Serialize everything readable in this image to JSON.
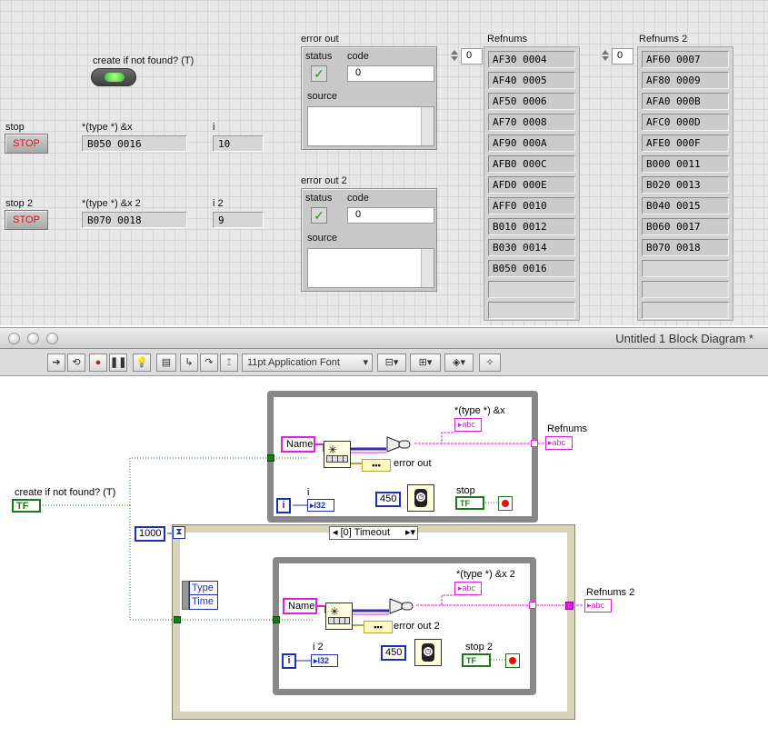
{
  "front_panel": {
    "create_label": "create if not found? (T)",
    "stop": {
      "label": "stop",
      "button": "STOP"
    },
    "stop2": {
      "label": "stop 2",
      "button": "STOP"
    },
    "typex": {
      "label": "*(type *) &x",
      "value": "B050 0016"
    },
    "typex2": {
      "label": "*(type *) &x 2",
      "value": "B070 0018"
    },
    "i": {
      "label": "i",
      "value": "10"
    },
    "i2": {
      "label": "i 2",
      "value": "9"
    },
    "error_out": {
      "label": "error out",
      "status": "status",
      "code": "code",
      "code_value": "0",
      "source": "source"
    },
    "error_out2": {
      "label": "error out 2",
      "status": "status",
      "code": "code",
      "code_value": "0",
      "source": "source"
    },
    "refnums": {
      "label": "Refnums",
      "index": "0",
      "items": [
        "AF30 0004",
        "AF40 0005",
        "AF50 0006",
        "AF70 0008",
        "AF90 000A",
        "AFB0 000C",
        "AFD0 000E",
        "AFF0 0010",
        "B010 0012",
        "B030 0014",
        "B050 0016",
        "",
        ""
      ]
    },
    "refnums2": {
      "label": "Refnums 2",
      "index": "0",
      "items": [
        "AF60 0007",
        "AF80 0009",
        "AFA0 000B",
        "AFC0 000D",
        "AFE0 000F",
        "B000 0011",
        "B020 0013",
        "B040 0015",
        "B060 0017",
        "B070 0018",
        "",
        "",
        ""
      ]
    }
  },
  "window": {
    "title": "Untitled 1 Block Diagram *"
  },
  "toolbar": {
    "font_label": "11pt Application Font"
  },
  "diagram": {
    "create_label": "create if not found? (T)",
    "create_term": "TF",
    "loop1": {
      "name_const": "Name",
      "typex_label": "*(type *) &x",
      "refnums_label": "Refnums",
      "error_label": "error out",
      "i_label": "i",
      "i_icon": "i",
      "i_term": "I32",
      "wait_const": "450",
      "stop_label": "stop",
      "stop_term": "TF"
    },
    "event": {
      "timeout_const": "1000",
      "case_label": "[0] Timeout",
      "type_label": "Type",
      "time_label": "Time"
    },
    "loop2": {
      "name_const": "Name",
      "typex_label": "*(type *) &x 2",
      "refnums_label": "Refnums 2",
      "error_label": "error out 2",
      "i_label": "i 2",
      "i_icon": "i",
      "i_term": "I32",
      "wait_const": "450",
      "stop_label": "stop 2",
      "stop_term": "TF"
    },
    "abc": "abc"
  },
  "colors": {
    "boolean_green": "#1a7a1a",
    "string_pink": "#e01ee0",
    "numeric_blue": "#1f2fb8",
    "stop_red": "#e31010"
  }
}
